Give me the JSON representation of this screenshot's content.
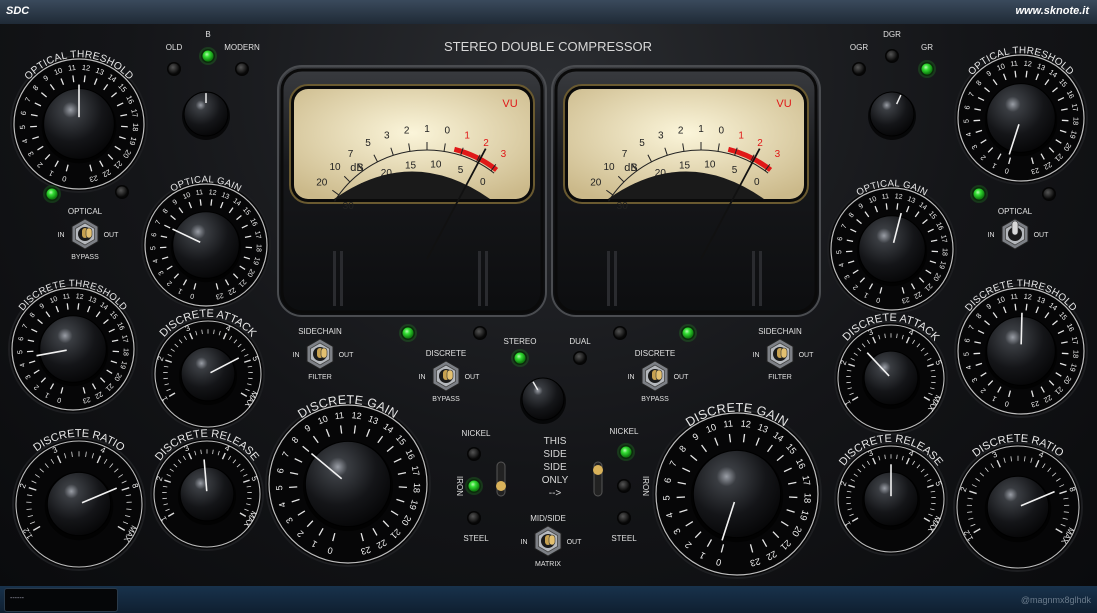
{
  "window": {
    "title_left": "SDC",
    "title_right": "www.sknote.it"
  },
  "plugin_title": "STEREO DOUBLE COMPRESSOR",
  "scales": {
    "knob24": [
      "0",
      "1",
      "2",
      "3",
      "4",
      "5",
      "6",
      "7",
      "8",
      "9",
      "10",
      "11",
      "12",
      "13",
      "14",
      "15",
      "16",
      "17",
      "18",
      "19",
      "20",
      "21",
      "22",
      "23"
    ],
    "knob5": [
      "1",
      "2",
      "3",
      "4",
      "5",
      "MAX"
    ],
    "ratio": [
      "1.2",
      "2",
      "3",
      "4",
      "8",
      "MAX"
    ]
  },
  "left": {
    "optical_threshold": {
      "label": "OPTICAL THRESHOLD",
      "value": 11.5
    },
    "mode": {
      "options": [
        "OLD",
        "B",
        "MODERN"
      ],
      "active": "B"
    },
    "optical_gain": {
      "label": "OPTICAL GAIN",
      "value": 7
    },
    "optical_bypass": {
      "top": "OPTICAL",
      "in": "IN",
      "out": "OUT",
      "bottom": "BYPASS"
    },
    "discrete_threshold": {
      "label": "DISCRETE THRESHOLD",
      "value": 4.5
    },
    "discrete_attack": {
      "label": "DISCRETE ATTACK",
      "value": 4.8
    },
    "discrete_ratio": {
      "label": "DISCRETE RATIO",
      "value": 4.9
    },
    "discrete_release": {
      "label": "DISCRETE RELEASE",
      "value": 3.4
    },
    "sidechain": {
      "top": "SIDECHAIN",
      "in": "IN",
      "out": "OUT",
      "bottom": "FILTER"
    },
    "discrete_bypass": {
      "top": "DISCRETE",
      "in": "IN",
      "out": "OUT",
      "bottom": "BYPASS"
    },
    "discrete_gain": {
      "label": "DISCRETE GAIN",
      "value": 8
    },
    "transformer": {
      "nickel": "NICKEL",
      "iron": "IRON",
      "steel": "STEEL"
    }
  },
  "right": {
    "optical_threshold": {
      "label": "OPTICAL THRESHOLD",
      "value": 0.2
    },
    "mode": {
      "options": [
        "OGR",
        "DGR",
        "GR"
      ],
      "active": "GR"
    },
    "optical_gain": {
      "label": "OPTICAL GAIN",
      "value": 12.5
    },
    "optical_bypass": {
      "top": "OPTICAL",
      "in": "IN",
      "out": "OUT",
      "bottom": ""
    },
    "discrete_threshold": {
      "label": "DISCRETE THRESHOLD",
      "value": 11.6
    },
    "discrete_attack": {
      "label": "DISCRETE ATTACK",
      "value": 2.6
    },
    "discrete_ratio": {
      "label": "DISCRETE RATIO",
      "value": 4.9
    },
    "discrete_release": {
      "label": "DISCRETE RELEASE",
      "value": 3.5
    },
    "sidechain": {
      "top": "SIDECHAIN",
      "in": "IN",
      "out": "OUT",
      "bottom": "FILTER"
    },
    "discrete_bypass": {
      "top": "DISCRETE",
      "in": "IN",
      "out": "OUT",
      "bottom": "BYPASS"
    },
    "discrete_gain": {
      "label": "DISCRETE GAIN",
      "value": 0.2
    },
    "transformer": {
      "nickel": "NICKEL",
      "iron": "IRON",
      "steel": "STEEL"
    }
  },
  "center": {
    "stereo_label": "STEREO",
    "dual_label": "DUAL",
    "link_mode": "STEREO",
    "this_side_only": [
      "THIS",
      "SIDE",
      "SIDE",
      "ONLY",
      "-->"
    ],
    "midside": {
      "top": "MID/SIDE",
      "in": "IN",
      "out": "OUT",
      "bottom": "MATRIX"
    }
  },
  "vu": {
    "scale_top": [
      "20",
      "10",
      "7",
      "5",
      "3",
      "2",
      "1",
      "0",
      "1",
      "2",
      "3"
    ],
    "scale_low": [
      "30",
      "25",
      "20",
      "15",
      "10",
      "5",
      "0"
    ],
    "db_label": "dB",
    "vu_label": "VU",
    "left_needle_db": 4.5,
    "right_needle_db": 4.5
  },
  "bottom": {
    "status": "------",
    "watermark": "@magnmx8glhdk"
  },
  "colors": {
    "led_on": "#2bd62b",
    "vu_red": "#e01818",
    "vu_face": "#f4ecc8",
    "knob_ring": "#e8e8e8"
  }
}
